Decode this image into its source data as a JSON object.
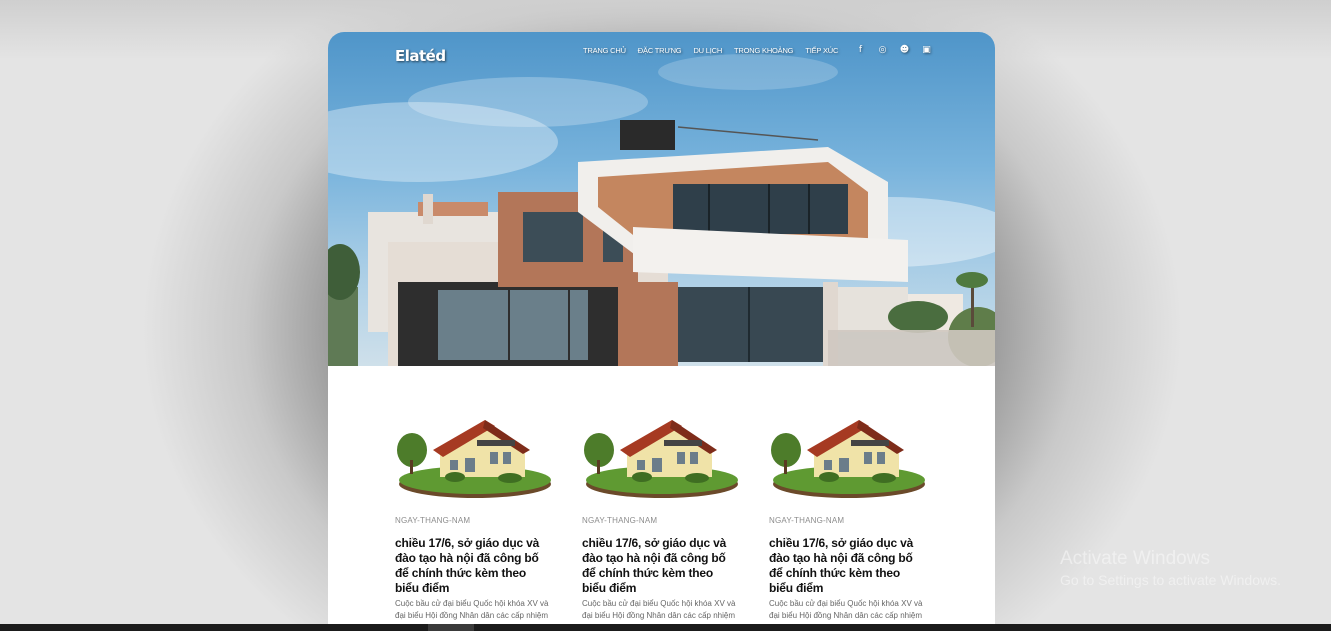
{
  "site": {
    "logo": "Elatéd"
  },
  "nav": {
    "items": [
      {
        "label": "TRANG CHỦ"
      },
      {
        "label": "ĐẶC TRƯNG"
      },
      {
        "label": "DU LỊCH"
      },
      {
        "label": "TRONG KHOẢNG"
      },
      {
        "label": "TIẾP XÚC"
      }
    ]
  },
  "socials": [
    {
      "icon": "facebook-icon",
      "glyph": "f"
    },
    {
      "icon": "dribbble-icon",
      "glyph": "◎"
    },
    {
      "icon": "reddit-icon",
      "glyph": "☻"
    },
    {
      "icon": "github-icon",
      "glyph": "▣"
    }
  ],
  "posts": [
    {
      "date": "NGAY-THANG-NAM",
      "title": "chiều 17/6, sở giáo dục và đào tạo hà nội đã công bố để chính thức kèm theo biểu điểm",
      "excerpt": "Cuộc bầu cử đại biểu Quốc hội khóa XV và đại biểu Hội đồng Nhân dân các cấp nhiệm kỳ"
    },
    {
      "date": "NGAY-THANG-NAM",
      "title": "chiều 17/6, sở giáo dục và đào tạo hà nội đã công bố để chính thức kèm theo biểu điểm",
      "excerpt": "Cuộc bầu cử đại biểu Quốc hội khóa XV và đại biểu Hội đồng Nhân dân các cấp nhiệm kỳ"
    },
    {
      "date": "NGAY-THANG-NAM",
      "title": "chiều 17/6, sở giáo dục và đào tạo hà nội đã công bố để chính thức kèm theo biểu điểm",
      "excerpt": "Cuộc bầu cử đại biểu Quốc hội khóa XV và đại biểu Hội đồng Nhân dân các cấp nhiệm kỳ"
    }
  ],
  "watermark": {
    "title": "Activate Windows",
    "subtitle": "Go to Settings to activate Windows."
  },
  "colors": {
    "accent_text": "#111111",
    "date_text": "#8c8c8c",
    "sky": "#78b3dc"
  }
}
